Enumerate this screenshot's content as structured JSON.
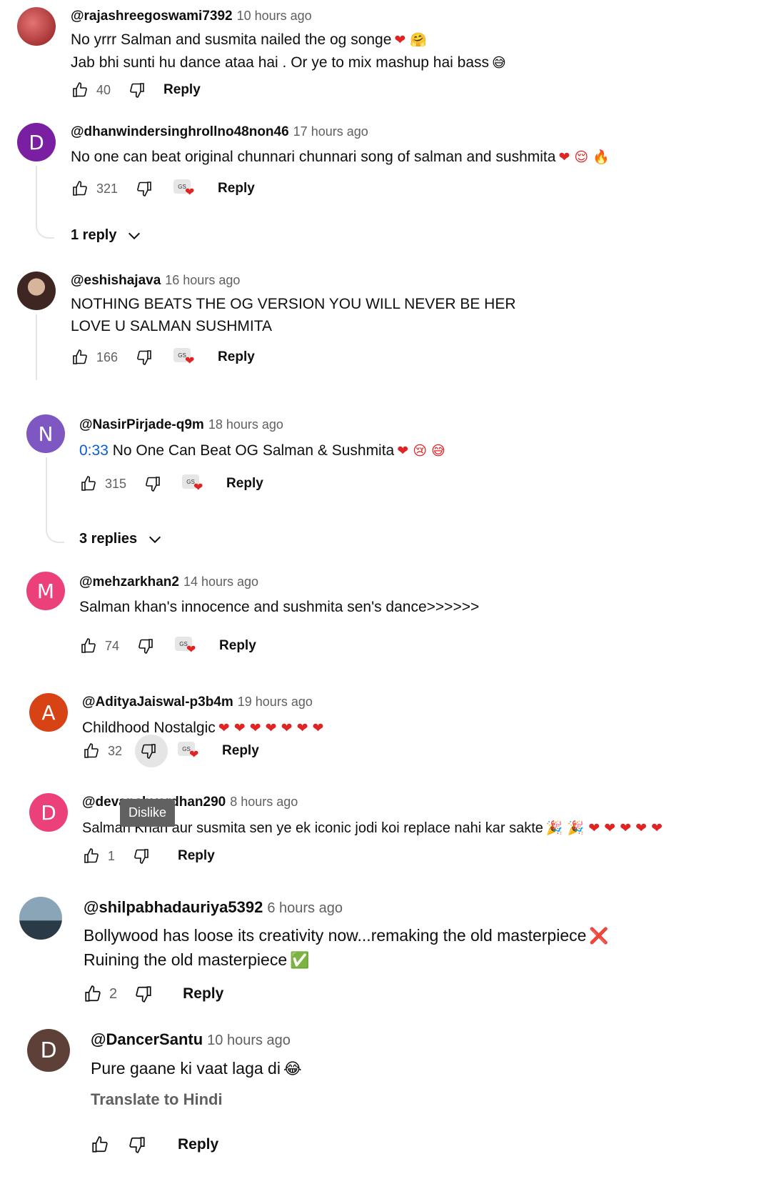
{
  "comments": [
    {
      "handle": "@rajashreegoswami7392",
      "time": "10 hours ago",
      "lines": [
        "No yrrr Salman and susmita nailed the og songe",
        "Jab bhi sunti hu dance ataa hai . Or ye to mix mashup hai bass"
      ],
      "line_emojis": [
        "❤ 🤗",
        "😅"
      ],
      "likes": "40",
      "reply_label": "Reply",
      "avatar_color": "#c0392b"
    },
    {
      "handle": "@dhanwindersinghrollno48non46",
      "time": "17 hours ago",
      "lines": [
        "No one can beat original chunnari chunnari song of salman and sushmita"
      ],
      "line_emojis": [
        "❤ 😌 🔥"
      ],
      "likes": "321",
      "reply_label": "Reply",
      "avatar_letter": "D",
      "avatar_color": "#7b1fa2",
      "replies_label": "1 reply"
    },
    {
      "handle": "@eshishajava",
      "time": "16 hours ago",
      "lines": [
        "NOTHING BEATS THE OG VERSION YOU WILL NEVER BE HER",
        "LOVE U SALMAN SUSHMITA"
      ],
      "likes": "166",
      "reply_label": "Reply",
      "avatar_color": "#8d6e63"
    },
    {
      "handle": "@NasirPirjade-q9m",
      "time": "18 hours ago",
      "timestamp_link": "0:33",
      "lines": [
        "No One Can Beat OG Salman & Sushmita"
      ],
      "line_emojis": [
        "❤ 😢 😅"
      ],
      "likes": "315",
      "reply_label": "Reply",
      "avatar_letter": "N",
      "avatar_color": "#7e57c2",
      "replies_label": "3 replies"
    },
    {
      "handle": "@mehzarkhan2",
      "time": "14 hours ago",
      "lines": [
        "Salman khan's innocence and sushmita sen's dance>>>>>>"
      ],
      "likes": "74",
      "reply_label": "Reply",
      "avatar_letter": "M",
      "avatar_color": "#ec407a"
    },
    {
      "handle": "@AdityaJaiswal-p3b4m",
      "time": "19 hours ago",
      "lines": [
        "Childhood Nostalgic"
      ],
      "line_emojis": [
        "❤ ❤ ❤ ❤ ❤ ❤ ❤"
      ],
      "likes": "32",
      "reply_label": "Reply",
      "avatar_letter": "A",
      "avatar_color": "#d84315"
    },
    {
      "handle": "@devanshvardhan290",
      "time": "8 hours ago",
      "lines": [
        "Salman Khan aur susmita sen ye ek iconic jodi koi replace nahi kar sakte"
      ],
      "line_emojis": [
        "🎉 🎉 ❤ ❤ ❤ ❤ ❤"
      ],
      "likes": "1",
      "reply_label": "Reply",
      "avatar_letter": "D",
      "avatar_color": "#ec407a"
    },
    {
      "handle": "@shilpabhadauriya5392",
      "time": "6 hours ago",
      "lines": [
        "Bollywood has loose its creativity now...remaking the old masterpiece",
        "Ruining the old masterpiece"
      ],
      "line_emojis": [
        "❌",
        "✅"
      ],
      "likes": "2",
      "reply_label": "Reply",
      "avatar_color": "#546e7a"
    },
    {
      "handle": "@DancerSantu",
      "time": "10 hours ago",
      "lines": [
        "Pure gaane ki vaat laga di"
      ],
      "line_emojis": [
        "😂"
      ],
      "translate_label": "Translate to Hindi",
      "reply_label": "Reply",
      "avatar_letter": "D",
      "avatar_color": "#5d4037"
    }
  ],
  "tooltip": {
    "label": "Dislike"
  },
  "creator_heart_text": "GS"
}
